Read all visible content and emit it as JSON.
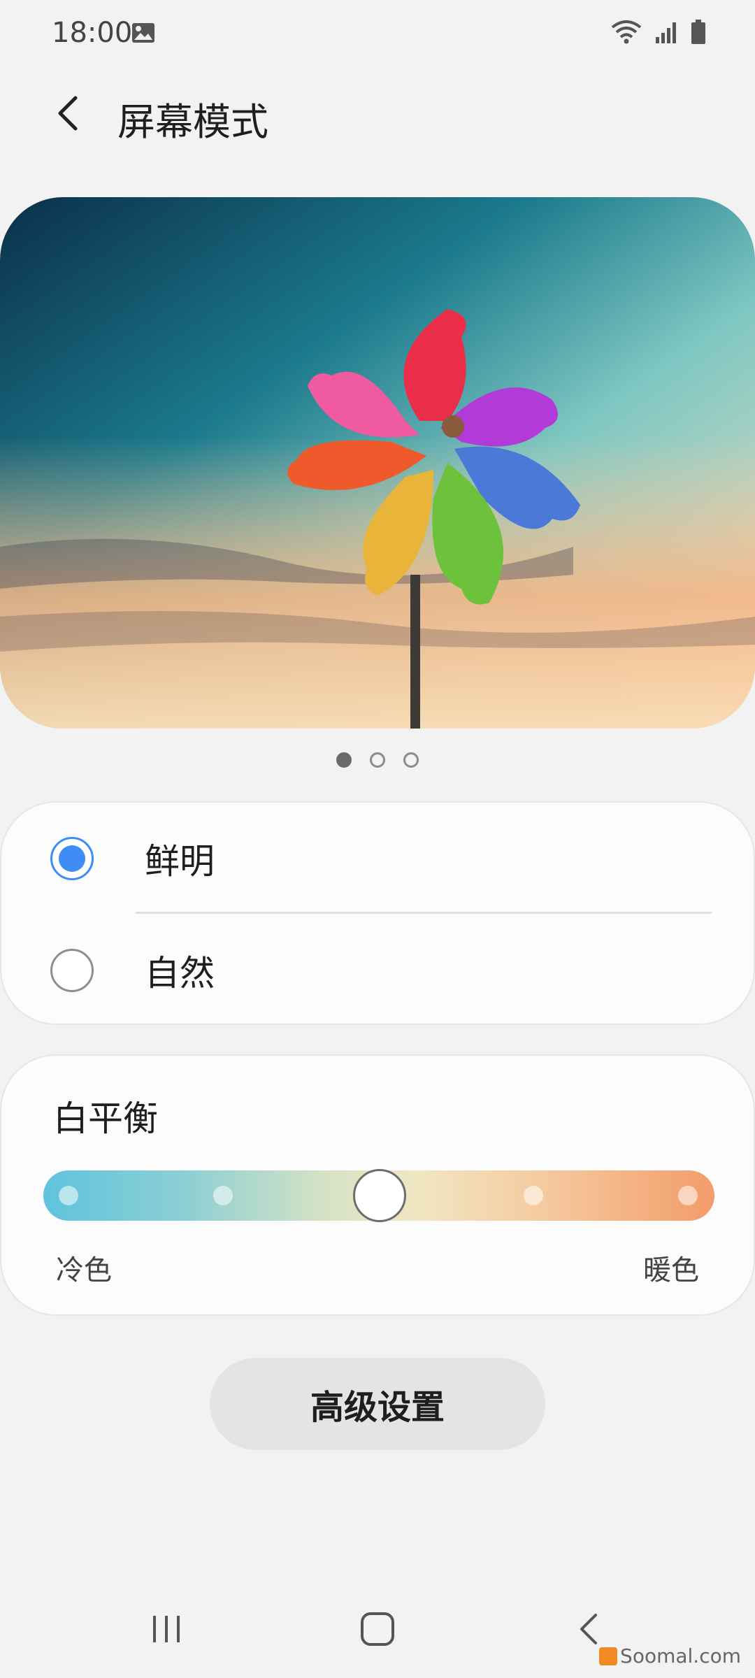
{
  "status_bar": {
    "time": "18:00",
    "left_icons": [
      "gallery-icon"
    ],
    "right_icons": [
      "wifi-icon",
      "signal-icon",
      "battery-icon"
    ]
  },
  "header": {
    "title": "屏幕模式",
    "back_icon": "back-arrow-icon"
  },
  "preview": {
    "pages": 3,
    "active_page": 1
  },
  "screen_mode": {
    "options": [
      {
        "label": "鲜明",
        "selected": true
      },
      {
        "label": "自然",
        "selected": false
      }
    ]
  },
  "white_balance": {
    "title": "白平衡",
    "low_label": "冷色",
    "high_label": "暖色",
    "steps": 5,
    "value_index": 2
  },
  "advanced_button": {
    "label": "高级设置"
  },
  "nav_bar": {
    "buttons": [
      "recents-icon",
      "home-icon",
      "back-icon"
    ]
  },
  "watermark": {
    "text": "Soomal.com"
  },
  "colors": {
    "accent": "#3e8df7",
    "background": "#f2f2f2",
    "card": "#fcfcfc"
  }
}
